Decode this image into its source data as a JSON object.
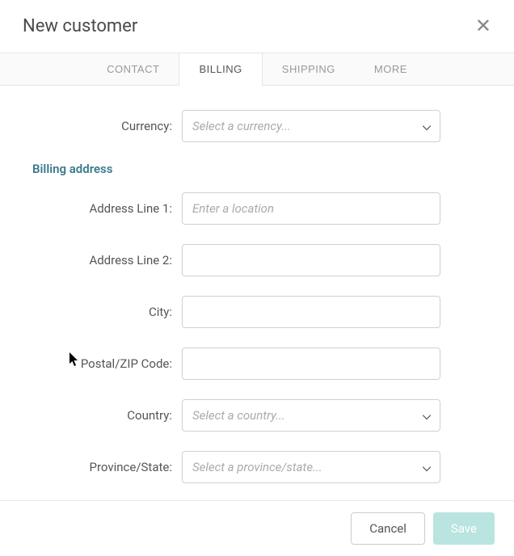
{
  "header": {
    "title": "New customer"
  },
  "tabs": [
    {
      "label": "CONTACT"
    },
    {
      "label": "BILLING"
    },
    {
      "label": "SHIPPING"
    },
    {
      "label": "MORE"
    }
  ],
  "form": {
    "currency": {
      "label": "Currency:",
      "placeholder": "Select a currency..."
    },
    "billing_section": "Billing address",
    "address1": {
      "label": "Address Line 1:",
      "placeholder": "Enter a location",
      "value": ""
    },
    "address2": {
      "label": "Address Line 2:",
      "value": ""
    },
    "city": {
      "label": "City:",
      "value": ""
    },
    "postal": {
      "label": "Postal/ZIP Code:",
      "value": ""
    },
    "country": {
      "label": "Country:",
      "placeholder": "Select a country..."
    },
    "province": {
      "label": "Province/State:",
      "placeholder": "Select a province/state..."
    }
  },
  "footer": {
    "cancel": "Cancel",
    "save": "Save"
  }
}
